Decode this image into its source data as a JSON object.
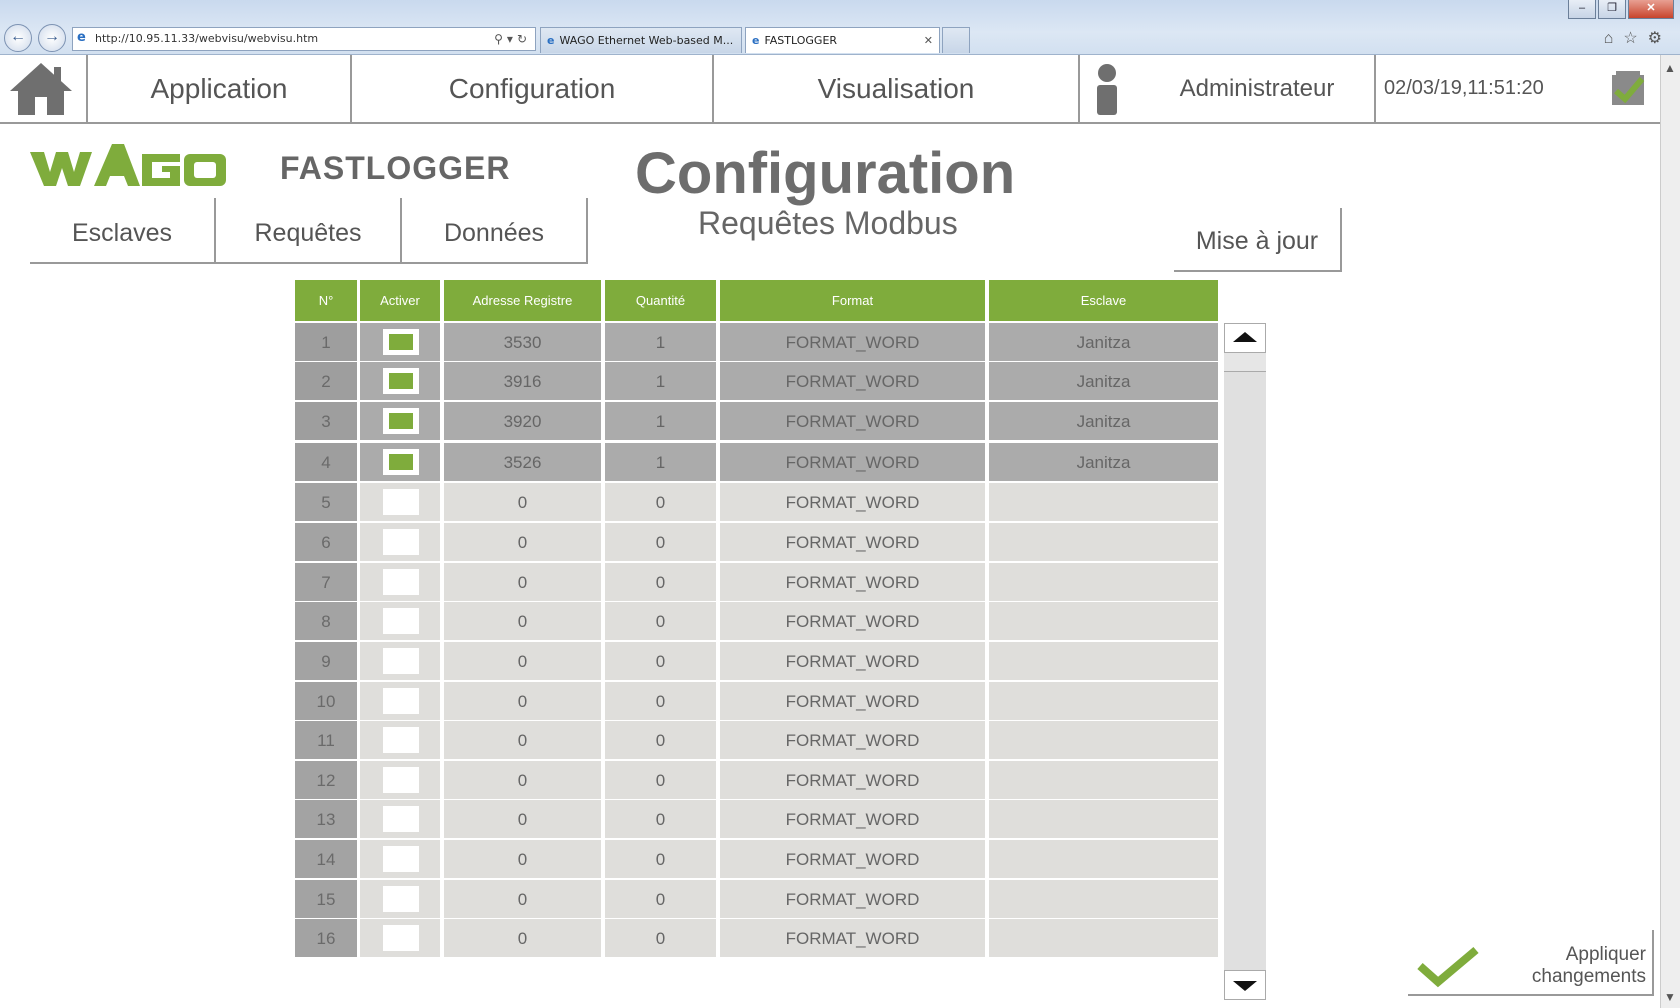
{
  "browser": {
    "url": "http://10.95.11.33/webvisu/webvisu.htm",
    "tabs": [
      {
        "label": "WAGO Ethernet Web-based M..."
      },
      {
        "label": "FASTLOGGER"
      }
    ]
  },
  "topmenu": {
    "items": [
      "Application",
      "Configuration",
      "Visualisation"
    ],
    "user": "Administrateur",
    "datetime": "02/03/19,11:51:20"
  },
  "header": {
    "brand": "FASTLOGGER",
    "title": "Configuration",
    "subtitle": "Requêtes Modbus",
    "tabs": [
      "Esclaves",
      "Requêtes",
      "Données"
    ],
    "refresh_label": "Mise à jour"
  },
  "table": {
    "columns": [
      "N°",
      "Activer",
      "Adresse Registre",
      "Quantité",
      "Format",
      "Esclave"
    ],
    "rows": [
      {
        "n": "1",
        "active": true,
        "addr": "3530",
        "qty": "1",
        "format": "FORMAT_WORD",
        "slave": "Janitza"
      },
      {
        "n": "2",
        "active": true,
        "addr": "3916",
        "qty": "1",
        "format": "FORMAT_WORD",
        "slave": "Janitza"
      },
      {
        "n": "3",
        "active": true,
        "addr": "3920",
        "qty": "1",
        "format": "FORMAT_WORD",
        "slave": "Janitza"
      },
      {
        "n": "4",
        "active": true,
        "addr": "3526",
        "qty": "1",
        "format": "FORMAT_WORD",
        "slave": "Janitza"
      },
      {
        "n": "5",
        "active": false,
        "addr": "0",
        "qty": "0",
        "format": "FORMAT_WORD",
        "slave": ""
      },
      {
        "n": "6",
        "active": false,
        "addr": "0",
        "qty": "0",
        "format": "FORMAT_WORD",
        "slave": ""
      },
      {
        "n": "7",
        "active": false,
        "addr": "0",
        "qty": "0",
        "format": "FORMAT_WORD",
        "slave": ""
      },
      {
        "n": "8",
        "active": false,
        "addr": "0",
        "qty": "0",
        "format": "FORMAT_WORD",
        "slave": ""
      },
      {
        "n": "9",
        "active": false,
        "addr": "0",
        "qty": "0",
        "format": "FORMAT_WORD",
        "slave": ""
      },
      {
        "n": "10",
        "active": false,
        "addr": "0",
        "qty": "0",
        "format": "FORMAT_WORD",
        "slave": ""
      },
      {
        "n": "11",
        "active": false,
        "addr": "0",
        "qty": "0",
        "format": "FORMAT_WORD",
        "slave": ""
      },
      {
        "n": "12",
        "active": false,
        "addr": "0",
        "qty": "0",
        "format": "FORMAT_WORD",
        "slave": ""
      },
      {
        "n": "13",
        "active": false,
        "addr": "0",
        "qty": "0",
        "format": "FORMAT_WORD",
        "slave": ""
      },
      {
        "n": "14",
        "active": false,
        "addr": "0",
        "qty": "0",
        "format": "FORMAT_WORD",
        "slave": ""
      },
      {
        "n": "15",
        "active": false,
        "addr": "0",
        "qty": "0",
        "format": "FORMAT_WORD",
        "slave": ""
      },
      {
        "n": "16",
        "active": false,
        "addr": "0",
        "qty": "0",
        "format": "FORMAT_WORD",
        "slave": ""
      }
    ]
  },
  "apply": {
    "line1": "Appliquer",
    "line2": "changements"
  },
  "colors": {
    "accent": "#7fac3c",
    "row_active": "#ababab",
    "row_inactive": "#dfdedb"
  },
  "icons": [
    "home-icon",
    "user-icon",
    "status-check-icon",
    "wago-logo",
    "scroll-up-icon",
    "scroll-down-icon",
    "apply-check-icon"
  ]
}
